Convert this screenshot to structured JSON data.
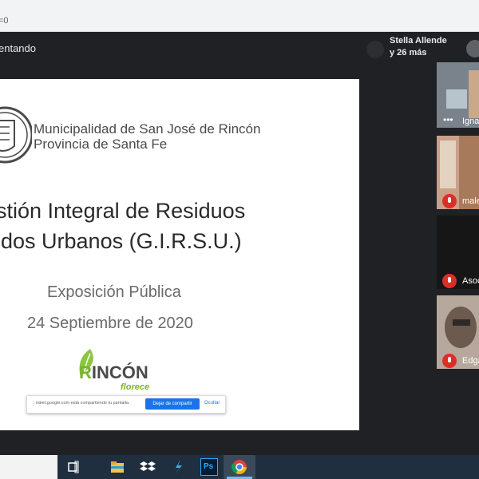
{
  "browser": {
    "url_fragment": "=0"
  },
  "meet": {
    "presenting_label": "entando",
    "participants_name": "Stella Allende",
    "participants_more": "y 26 más"
  },
  "slide": {
    "municipality_line1": "Municipalidad de San José de Rincón",
    "municipality_line2": "Provincia de Santa Fe",
    "title_line1": "stión Integral de Residuos",
    "title_line2": "idos Urbanos (G.I.R.S.U.)",
    "subtitle": "Exposición Pública",
    "date": "24 Septiembre de 2020",
    "logo_word_rest": "INCÓN",
    "logo_word_r": "R",
    "logo_tagline": "florece"
  },
  "share_bar": {
    "message": "meet.google.com está compartiendo tu pantalla.",
    "stop_label": "Dejar de compartir",
    "hide_label": "Ocultar"
  },
  "tiles": [
    {
      "name": "Igna"
    },
    {
      "name": "male"
    },
    {
      "name": "Asoc"
    },
    {
      "name": "Edga"
    }
  ],
  "colors": {
    "meet_bg": "#202124",
    "stop_button": "#1a73e8",
    "muted_mic": "#d93025",
    "logo_green": "#7ab32e",
    "taskbar": "#1f2f3f"
  },
  "taskbar": {
    "icons": [
      "task-view-icon",
      "file-explorer-icon",
      "dropbox-icon",
      "vscode-icon",
      "photoshop-icon",
      "chrome-icon"
    ],
    "photoshop_label": "Ps"
  }
}
